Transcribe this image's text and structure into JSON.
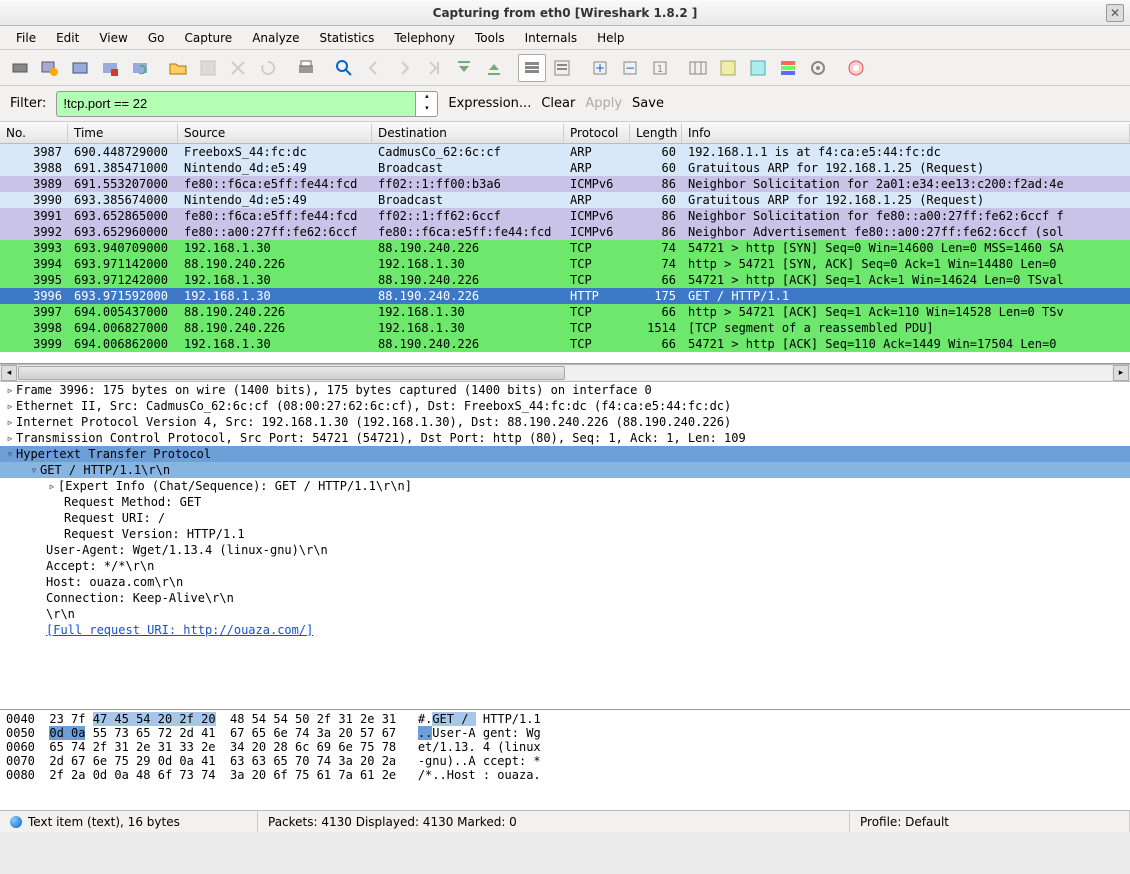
{
  "window": {
    "title": "Capturing from eth0    [Wireshark 1.8.2 ]"
  },
  "menu": [
    "File",
    "Edit",
    "View",
    "Go",
    "Capture",
    "Analyze",
    "Statistics",
    "Telephony",
    "Tools",
    "Internals",
    "Help"
  ],
  "filter": {
    "label": "Filter:",
    "value": "!tcp.port == 22",
    "expression": "Expression...",
    "clear": "Clear",
    "apply": "Apply",
    "save": "Save"
  },
  "columns": {
    "no": "No.",
    "time": "Time",
    "source": "Source",
    "destination": "Destination",
    "protocol": "Protocol",
    "length": "Length",
    "info": "Info"
  },
  "packets": [
    {
      "no": "3987",
      "time": "690.448729000",
      "src": "FreeboxS_44:fc:dc",
      "dst": "CadmusCo_62:6c:cf",
      "prot": "ARP",
      "len": "60",
      "info": "192.168.1.1 is at f4:ca:e5:44:fc:dc",
      "cls": "clr-arp1"
    },
    {
      "no": "3988",
      "time": "691.385471000",
      "src": "Nintendo_4d:e5:49",
      "dst": "Broadcast",
      "prot": "ARP",
      "len": "60",
      "info": "Gratuitous ARP for 192.168.1.25 (Request)",
      "cls": "clr-arp1"
    },
    {
      "no": "3989",
      "time": "691.553207000",
      "src": "fe80::f6ca:e5ff:fe44:fcd",
      "dst": "ff02::1:ff00:b3a6",
      "prot": "ICMPv6",
      "len": "86",
      "info": "Neighbor Solicitation for 2a01:e34:ee13:c200:f2ad:4e",
      "cls": "clr-icmp"
    },
    {
      "no": "3990",
      "time": "693.385674000",
      "src": "Nintendo_4d:e5:49",
      "dst": "Broadcast",
      "prot": "ARP",
      "len": "60",
      "info": "Gratuitous ARP for 192.168.1.25 (Request)",
      "cls": "clr-arp1"
    },
    {
      "no": "3991",
      "time": "693.652865000",
      "src": "fe80::f6ca:e5ff:fe44:fcd",
      "dst": "ff02::1:ff62:6ccf",
      "prot": "ICMPv6",
      "len": "86",
      "info": "Neighbor Solicitation for fe80::a00:27ff:fe62:6ccf f",
      "cls": "clr-icmp"
    },
    {
      "no": "3992",
      "time": "693.652960000",
      "src": "fe80::a00:27ff:fe62:6ccf",
      "dst": "fe80::f6ca:e5ff:fe44:fcd",
      "prot": "ICMPv6",
      "len": "86",
      "info": "Neighbor Advertisement fe80::a00:27ff:fe62:6ccf (sol",
      "cls": "clr-icmp"
    },
    {
      "no": "3993",
      "time": "693.940709000",
      "src": "192.168.1.30",
      "dst": "88.190.240.226",
      "prot": "TCP",
      "len": "74",
      "info": "54721 > http [SYN] Seq=0 Win=14600 Len=0 MSS=1460 SA",
      "cls": "clr-tcp"
    },
    {
      "no": "3994",
      "time": "693.971142000",
      "src": "88.190.240.226",
      "dst": "192.168.1.30",
      "prot": "TCP",
      "len": "74",
      "info": "http > 54721 [SYN, ACK] Seq=0 Ack=1 Win=14480 Len=0 ",
      "cls": "clr-tcp"
    },
    {
      "no": "3995",
      "time": "693.971242000",
      "src": "192.168.1.30",
      "dst": "88.190.240.226",
      "prot": "TCP",
      "len": "66",
      "info": "54721 > http [ACK] Seq=1 Ack=1 Win=14624 Len=0 TSval",
      "cls": "clr-tcp"
    },
    {
      "no": "3996",
      "time": "693.971592000",
      "src": "192.168.1.30",
      "dst": "88.190.240.226",
      "prot": "HTTP",
      "len": "175",
      "info": "GET / HTTP/1.1",
      "cls": "clr-sel"
    },
    {
      "no": "3997",
      "time": "694.005437000",
      "src": "88.190.240.226",
      "dst": "192.168.1.30",
      "prot": "TCP",
      "len": "66",
      "info": "http > 54721 [ACK] Seq=1 Ack=110 Win=14528 Len=0 TSv",
      "cls": "clr-tcp"
    },
    {
      "no": "3998",
      "time": "694.006827000",
      "src": "88.190.240.226",
      "dst": "192.168.1.30",
      "prot": "TCP",
      "len": "1514",
      "info": "[TCP segment of a reassembled PDU]",
      "cls": "clr-tcp"
    },
    {
      "no": "3999",
      "time": "694.006862000",
      "src": "192.168.1.30",
      "dst": "88.190.240.226",
      "prot": "TCP",
      "len": "66",
      "info": "54721 > http [ACK] Seq=110 Ack=1449 Win=17504 Len=0 ",
      "cls": "clr-tcp"
    }
  ],
  "details": {
    "frame": "Frame 3996: 175 bytes on wire (1400 bits), 175 bytes captured (1400 bits) on interface 0",
    "eth": "Ethernet II, Src: CadmusCo_62:6c:cf (08:00:27:62:6c:cf), Dst: FreeboxS_44:fc:dc (f4:ca:e5:44:fc:dc)",
    "ip": "Internet Protocol Version 4, Src: 192.168.1.30 (192.168.1.30), Dst: 88.190.240.226 (88.190.240.226)",
    "tcp": "Transmission Control Protocol, Src Port: 54721 (54721), Dst Port: http (80), Seq: 1, Ack: 1, Len: 109",
    "http": "Hypertext Transfer Protocol",
    "get": "GET / HTTP/1.1\\r\\n",
    "expert": "[Expert Info (Chat/Sequence): GET / HTTP/1.1\\r\\n]",
    "method": "Request Method: GET",
    "uri": "Request URI: /",
    "version": "Request Version: HTTP/1.1",
    "ua": "User-Agent: Wget/1.13.4 (linux-gnu)\\r\\n",
    "accept": "Accept: */*\\r\\n",
    "host": "Host: ouaza.com\\r\\n",
    "conn": "Connection: Keep-Alive\\r\\n",
    "crlf": "\\r\\n",
    "full_uri": "[Full request URI: http://ouaza.com/]"
  },
  "hex": {
    "r1_off": "0040",
    "r1_a": "23 7f ",
    "r1_hl": "47 45 54 20 2f 20",
    "r1_b": "  48 54 54 50 2f 31 2e 31",
    "r1_asc_a": "#.",
    "r1_asc_hl": "GET / ",
    "r1_asc_b": " HTTP/1.1",
    "r2_off": "0050",
    "r2_hl": "0d 0a",
    "r2_a": " 55 73 65 72 2d 41  67 65 6e 74 3a 20 57 67",
    "r2_asc_hl": "..",
    "r2_asc_a": "User-A gent: Wg",
    "r3_off": "0060",
    "r3_a": "65 74 2f 31 2e 31 33 2e  34 20 28 6c 69 6e 75 78",
    "r3_asc": "et/1.13. 4 (linux",
    "r4_off": "0070",
    "r4_a": "2d 67 6e 75 29 0d 0a 41  63 63 65 70 74 3a 20 2a",
    "r4_asc": "-gnu)..A ccept: *",
    "r5_off": "0080",
    "r5_a": "2f 2a 0d 0a 48 6f 73 74  3a 20 6f 75 61 7a 61 2e",
    "r5_asc": "/*..Host : ouaza."
  },
  "status": {
    "left": "Text item (text), 16 bytes",
    "mid": "Packets: 4130 Displayed: 4130 Marked: 0",
    "right": "Profile: Default"
  }
}
